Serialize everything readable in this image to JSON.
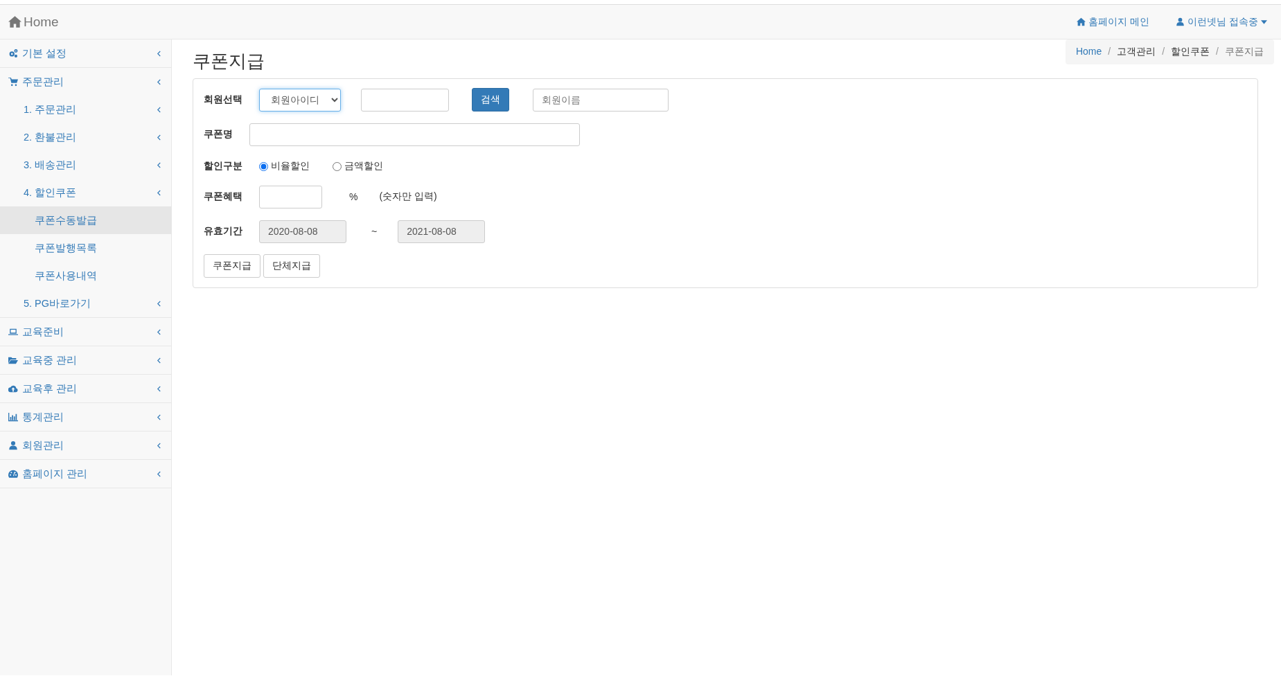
{
  "navbar": {
    "brand": "Home",
    "links": [
      {
        "label": "홈페이지 메인",
        "dropdown": false
      },
      {
        "label": "이런넷님 접속중",
        "dropdown": true
      }
    ]
  },
  "sidebar": {
    "items": [
      {
        "label": "기본 설정",
        "submenu": true,
        "selected": false
      },
      {
        "label": "주문관리",
        "submenu": true,
        "selected": false,
        "children": [
          {
            "label": "1. 주문관리",
            "submenu": true,
            "selected": false
          },
          {
            "label": "2. 환불관리",
            "submenu": true,
            "selected": false
          },
          {
            "label": "3. 배송관리",
            "submenu": true,
            "selected": false
          },
          {
            "label": "4. 할인쿠폰",
            "submenu": true,
            "selected": false,
            "children": [
              {
                "label": "쿠폰수동발급",
                "submenu": false,
                "selected": true
              },
              {
                "label": "쿠폰발행목록",
                "submenu": false,
                "selected": false
              },
              {
                "label": "쿠폰사용내역",
                "submenu": false,
                "selected": false
              }
            ]
          },
          {
            "label": "5. PG바로가기",
            "submenu": true,
            "selected": false
          }
        ]
      },
      {
        "label": "교육준비",
        "submenu": true,
        "selected": false
      },
      {
        "label": "교육중 관리",
        "submenu": true,
        "selected": false
      },
      {
        "label": "교육후 관리",
        "submenu": true,
        "selected": false
      },
      {
        "label": "통계관리",
        "submenu": true,
        "selected": false
      },
      {
        "label": "회원관리",
        "submenu": true,
        "selected": false
      },
      {
        "label": "홈페이지 관리",
        "submenu": true,
        "selected": false
      }
    ]
  },
  "breadcrumb": {
    "items": [
      {
        "label": "Home",
        "kind": "link"
      },
      {
        "label": "고객관리",
        "kind": "plain"
      },
      {
        "label": "할인쿠폰",
        "kind": "plain"
      },
      {
        "label": "쿠폰지급",
        "kind": "active"
      }
    ],
    "separators": [
      "/",
      "/",
      "/"
    ]
  },
  "page_title": "쿠폰지급",
  "form": {
    "member": {
      "label": "회원선택",
      "select": "회원아이디",
      "search_button": "검색",
      "name_field": {
        "placeholder": "회원이름"
      }
    },
    "coupon_name": {
      "label": "쿠폰명"
    },
    "discount_type": {
      "label": "할인구분",
      "options": [
        {
          "label": "비율할인",
          "selected": true
        },
        {
          "label": "금액할인",
          "selected": false
        }
      ]
    },
    "benefit": {
      "label": "쿠폰혜택",
      "unit": "%",
      "hint": "(숫자만 입력)"
    },
    "period": {
      "label": "유효기간",
      "start": {
        "value": "2020-08-08",
        "disabled": true
      },
      "separator": "~",
      "end": {
        "value": "2021-08-08",
        "disabled": true
      }
    },
    "buttons": [
      "쿠폰지급",
      "단체지급"
    ]
  }
}
